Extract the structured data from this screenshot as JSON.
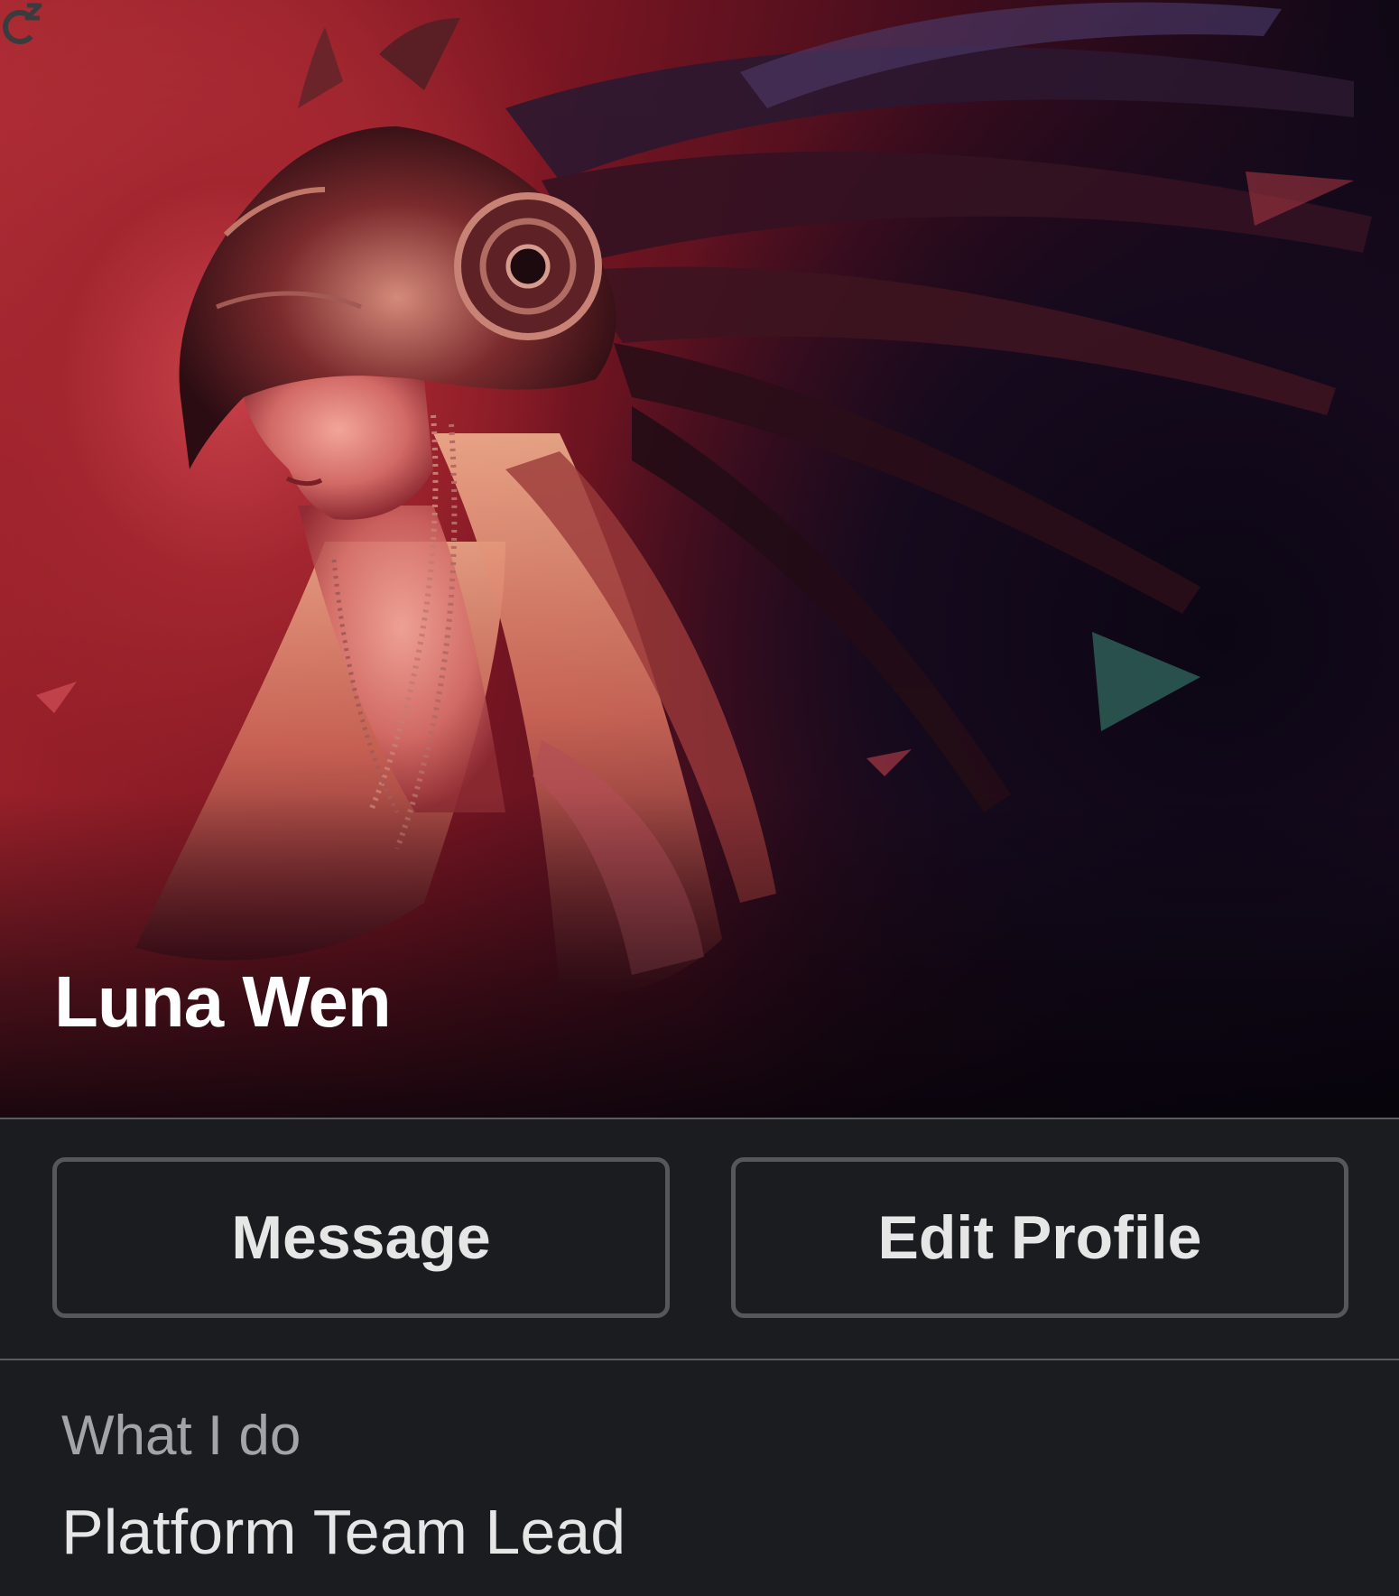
{
  "profile": {
    "name": "Luna Wen",
    "status_icon": "snooze-icon",
    "cover_image": "cover-photo"
  },
  "actions": {
    "message_label": "Message",
    "edit_profile_label": "Edit Profile"
  },
  "fields": {
    "what_i_do": {
      "label": "What I do",
      "value": "Platform Team Lead"
    }
  },
  "colors": {
    "background": "#1b1c1f",
    "button_border": "#55575b",
    "primary_text": "#e6e6e6",
    "secondary_text": "#a3a4a7",
    "name_text": "#ffffff"
  }
}
